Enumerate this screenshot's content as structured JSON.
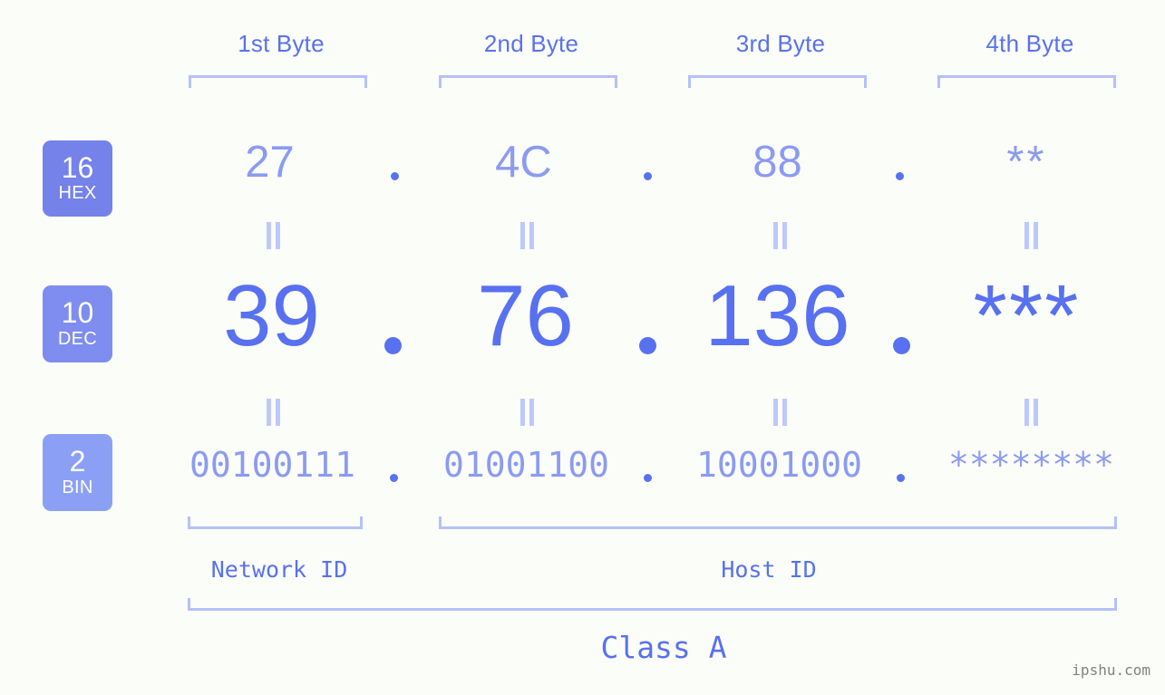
{
  "page": {
    "background": "#fbfdf8",
    "accent": "#5871f0",
    "accent_light": "#8b9bf2",
    "bracket_color": "#b5c0fb",
    "watermark": "ipshu.com"
  },
  "byte_headers": [
    {
      "label": "1st Byte"
    },
    {
      "label": "2nd Byte"
    },
    {
      "label": "3rd Byte"
    },
    {
      "label": "4th Byte"
    }
  ],
  "bases": [
    {
      "num": "16",
      "name": "HEX",
      "color": "#7582ea"
    },
    {
      "num": "10",
      "name": "DEC",
      "color": "#7e8def"
    },
    {
      "num": "2",
      "name": "BIN",
      "color": "#8ba0f5"
    }
  ],
  "rows": {
    "hex": {
      "base_num": "16",
      "base_name": "HEX",
      "values": [
        "27",
        "4C",
        "88",
        "**"
      ],
      "separator": "."
    },
    "dec": {
      "base_num": "10",
      "base_name": "DEC",
      "values": [
        "39",
        "76",
        "136",
        "***"
      ],
      "separator": "."
    },
    "bin": {
      "base_num": "2",
      "base_name": "BIN",
      "values": [
        "00100111",
        "01001100",
        "10001000",
        "********"
      ],
      "separator": "."
    }
  },
  "equals_symbol": "||",
  "segments": {
    "network_id": "Network ID",
    "host_id": "Host ID",
    "class": "Class A"
  }
}
